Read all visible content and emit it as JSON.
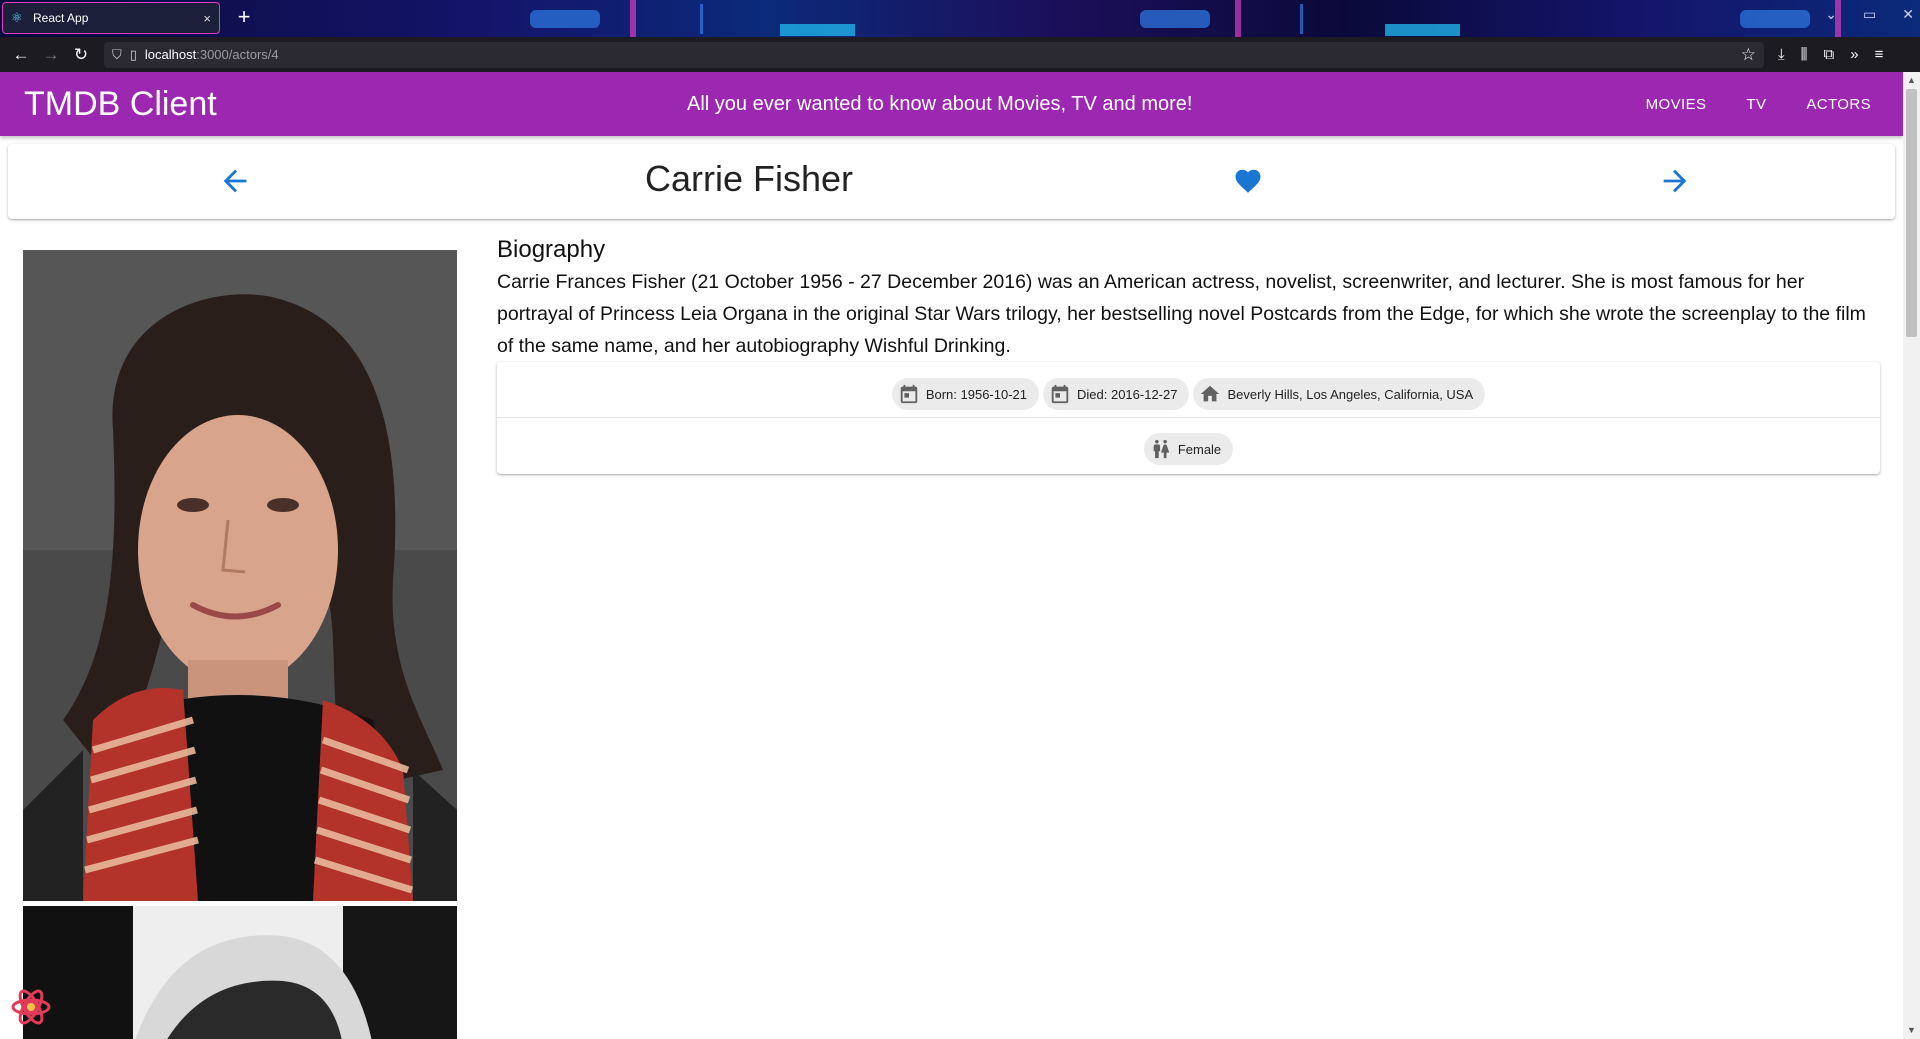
{
  "browser": {
    "tab_title": "React App",
    "tab_close": "×",
    "new_tab": "+",
    "url_host": "localhost",
    "url_path": ":3000/actors/4"
  },
  "app": {
    "brand": "TMDB Client",
    "tagline": "All you ever wanted to know about Movies, TV and more!",
    "menu": [
      "MOVIES",
      "TV",
      "ACTORS"
    ]
  },
  "actor": {
    "name": "Carrie Fisher",
    "bio_title": "Biography",
    "biography": "Carrie Frances Fisher (21 October 1956 - 27 December 2016) was an American actress, novelist, screenwriter, and lecturer. She is most famous for her portrayal of Princess Leia Organa in the original Star Wars trilogy, her bestselling novel Postcards from the Edge, for which she wrote the screenplay to the film of the same name, and her autobiography Wishful Drinking.",
    "born": "Born: 1956-10-21",
    "died": "Died: 2016-12-27",
    "birthplace": "Beverly Hills, Los Angeles, California, USA",
    "gender": "Female"
  },
  "icons": {
    "back": "arrow-left-icon",
    "forward": "arrow-right-icon",
    "favorite": "heart-icon",
    "calendar": "calendar-icon",
    "home": "home-icon",
    "gender": "wc-icon"
  },
  "colors": {
    "appbar": "#9c27b0",
    "accent": "#1976d2",
    "chip": "#ebebeb"
  }
}
